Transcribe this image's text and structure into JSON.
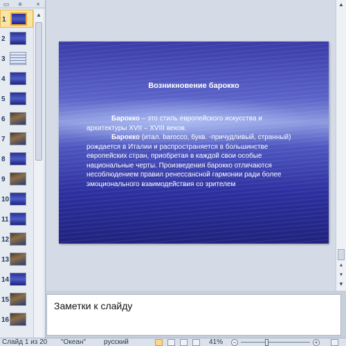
{
  "thumbnails": {
    "tabs": [
      "▭",
      "≡"
    ],
    "close": "×",
    "selected_index": 0,
    "slides": [
      {
        "num": "1",
        "style": "sel"
      },
      {
        "num": "2",
        "style": "plain"
      },
      {
        "num": "3",
        "style": "list"
      },
      {
        "num": "4",
        "style": "plain"
      },
      {
        "num": "5",
        "style": "plain"
      },
      {
        "num": "6",
        "style": "photo"
      },
      {
        "num": "7",
        "style": "photo"
      },
      {
        "num": "8",
        "style": "plain"
      },
      {
        "num": "9",
        "style": "photo"
      },
      {
        "num": "10",
        "style": "plain"
      },
      {
        "num": "11",
        "style": "plain"
      },
      {
        "num": "12",
        "style": "photo"
      },
      {
        "num": "13",
        "style": "photo"
      },
      {
        "num": "14",
        "style": "plain"
      },
      {
        "num": "15",
        "style": "photo"
      },
      {
        "num": "16",
        "style": "photo"
      }
    ]
  },
  "slide": {
    "title": "Возникновение барокко",
    "p1_bold": "Барокко",
    "p1_text": " – это стиль европейского искусства и архитектуры XVII – XVIII веков.",
    "p2_bold": "Барокко",
    "p2_text": " (итал. barocco, букв. -причудливый, странный) рождается в Италии и распространяется в большинстве европейских стран, приобретая в каждой свои особые национальные черты. Произведения барокко отличаются несоблюдением правил ренессансной гармонии ради более эмоционального взаимодействия со зрителем"
  },
  "notes": {
    "placeholder": "Заметки к слайду"
  },
  "status_bar": {
    "slide_counter": "Слайд 1 из 20",
    "theme": "\"Океан\"",
    "language": "русский",
    "zoom": "41%",
    "zoom_level_fraction": 0.38
  },
  "colors": {
    "selection": "#fbe3a2",
    "slide_dark": "#20227e",
    "slide_light": "#8e9be0"
  }
}
